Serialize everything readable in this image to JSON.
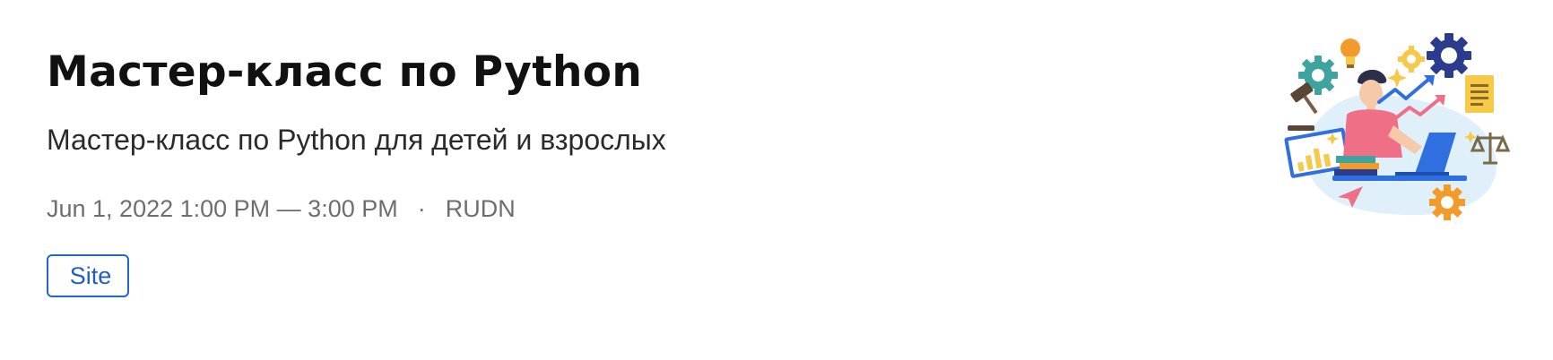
{
  "event": {
    "title": "Мастер-класс по Python",
    "subtitle": "Мастер-класс по Python для детей и взрослых",
    "datetime": "Jun 1, 2022 1:00 PM — 3:00 PM",
    "separator": "·",
    "location": "RUDN",
    "site_button_label": "Site"
  },
  "illustration": {
    "icon": "programmer-illustration",
    "colors": {
      "accent_blue": "#2f6fe0",
      "accent_pink": "#ef6f86",
      "accent_orange": "#f39b2a",
      "accent_yellow": "#f7c948",
      "accent_teal": "#3fa3a0",
      "background_blob": "#dff0fa"
    }
  },
  "colors": {
    "title": "#111111",
    "subtitle": "#2a2a2a",
    "meta": "#6e6e6e",
    "link": "#1f5fbf"
  }
}
